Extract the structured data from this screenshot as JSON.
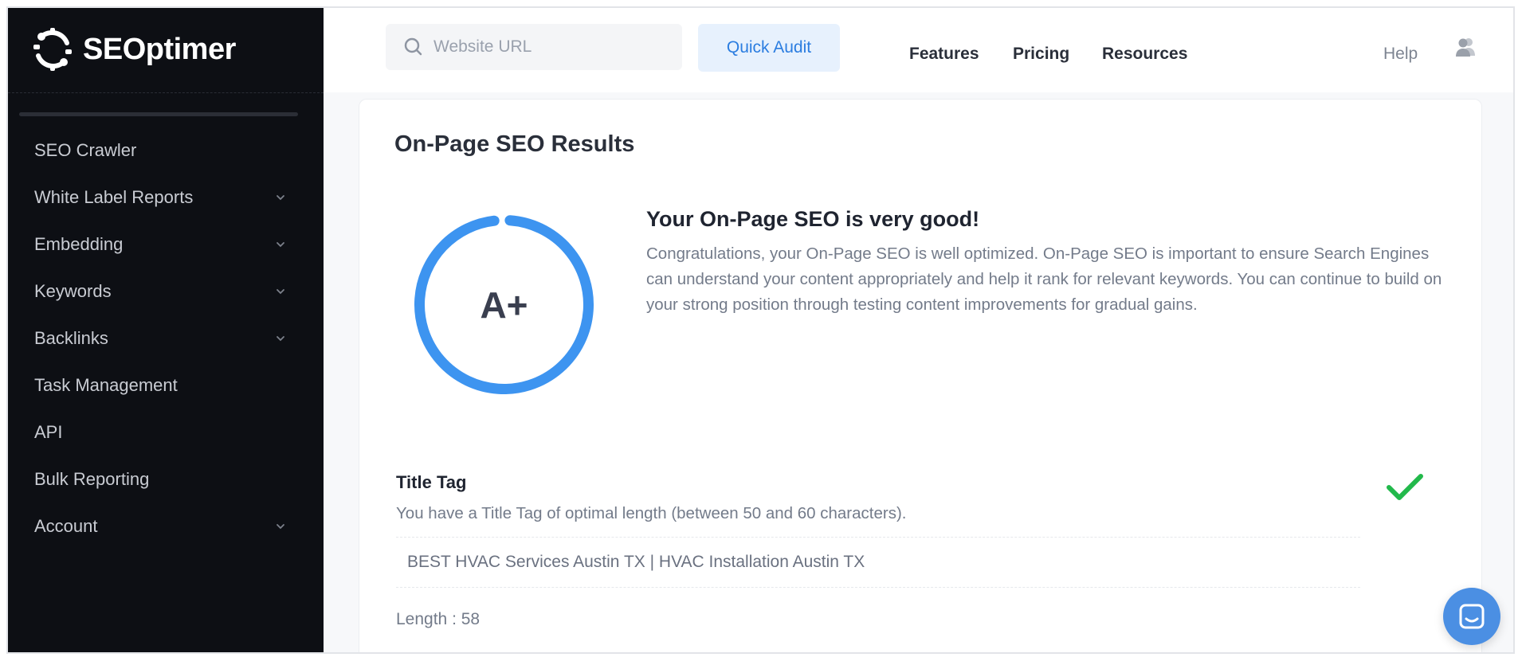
{
  "app": {
    "name": "SEOptimer"
  },
  "sidebar": {
    "items": [
      {
        "label": "SEO Crawler",
        "has_submenu": false
      },
      {
        "label": "White Label Reports",
        "has_submenu": true
      },
      {
        "label": "Embedding",
        "has_submenu": true
      },
      {
        "label": "Keywords",
        "has_submenu": true
      },
      {
        "label": "Backlinks",
        "has_submenu": true
      },
      {
        "label": "Task Management",
        "has_submenu": false
      },
      {
        "label": "API",
        "has_submenu": false
      },
      {
        "label": "Bulk Reporting",
        "has_submenu": false
      },
      {
        "label": "Account",
        "has_submenu": true
      }
    ]
  },
  "topbar": {
    "search_placeholder": "Website URL",
    "quick_audit_label": "Quick Audit",
    "links": [
      "Features",
      "Pricing",
      "Resources"
    ],
    "help_label": "Help"
  },
  "results": {
    "title": "On-Page SEO Results",
    "grade": "A+",
    "grade_progress": 0.97,
    "summary_title": "Your On-Page SEO is very good!",
    "summary_text": "Congratulations, your On-Page SEO is well optimized. On-Page SEO is important to ensure Search Engines can understand your content appropriately and help it rank for relevant keywords. You can continue to build on your strong position through testing content improvements for gradual gains."
  },
  "title_tag": {
    "heading": "Title Tag",
    "description": "You have a Title Tag of optimal length (between 50 and 60 characters).",
    "value": "BEST HVAC Services Austin TX | HVAC Installation Austin TX",
    "length_text": "Length : 58",
    "status": "pass"
  },
  "colors": {
    "accent": "#3d94f0",
    "pass": "#22b94b",
    "sidebar_bg": "#0d0f14"
  }
}
